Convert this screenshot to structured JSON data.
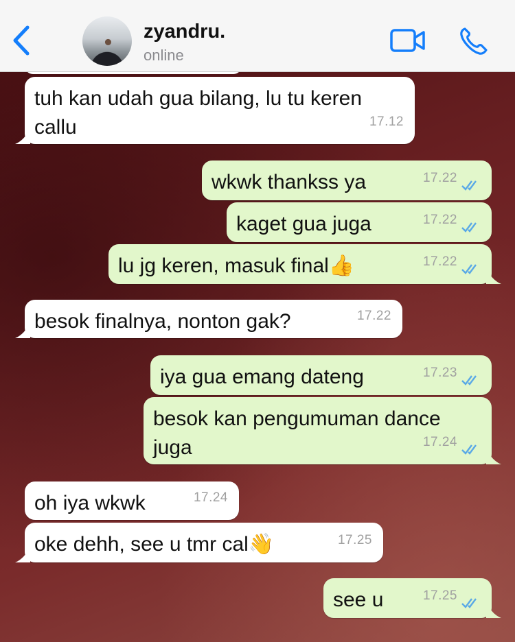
{
  "header": {
    "contact_name": "zyandru.",
    "status": "online"
  },
  "colors": {
    "accent": "#147efb",
    "incoming_bubble": "#ffffff",
    "outgoing_bubble": "#e2f7cb",
    "read_ticks": "#5aa9e6"
  },
  "icons": {
    "back": "chevron-left-icon",
    "video": "video-camera-icon",
    "call": "phone-icon",
    "read": "double-check-icon"
  },
  "messages": [
    {
      "direction": "in",
      "text": "tuh kan udah gua bilang, lu tu keren\ncallu",
      "time": "17.12"
    },
    {
      "direction": "out",
      "text": "wkwk thankss ya",
      "time": "17.22"
    },
    {
      "direction": "out",
      "text": "kaget gua juga",
      "time": "17.22"
    },
    {
      "direction": "out",
      "text": "lu jg keren, masuk final",
      "emoji": "👍",
      "time": "17.22"
    },
    {
      "direction": "in",
      "text": "besok finalnya, nonton gak?",
      "time": "17.22"
    },
    {
      "direction": "out",
      "text": "iya gua emang dateng",
      "time": "17.23"
    },
    {
      "direction": "out",
      "text": "besok kan pengumuman dance\njuga",
      "time": "17.24"
    },
    {
      "direction": "in",
      "text": "oh iya wkwk",
      "time": "17.24"
    },
    {
      "direction": "in",
      "text": "oke dehh, see u tmr cal",
      "emoji": "👋",
      "time": "17.25"
    },
    {
      "direction": "out",
      "text": "see u",
      "time": "17.25"
    }
  ]
}
